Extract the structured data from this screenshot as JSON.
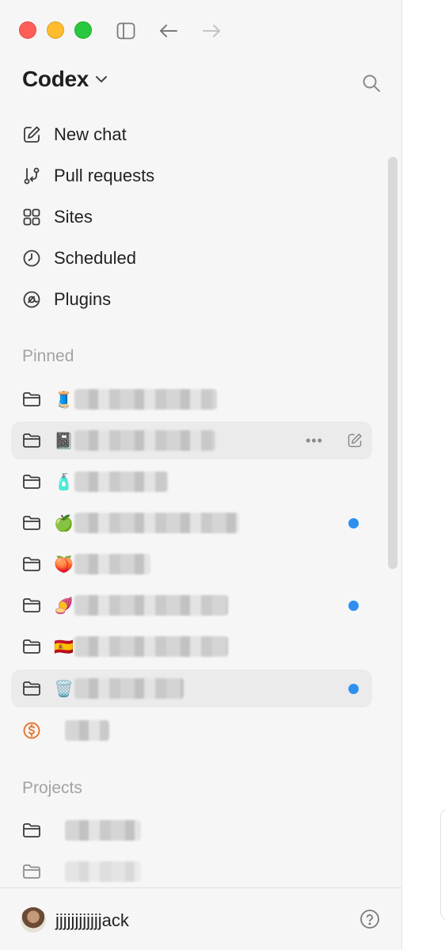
{
  "app": {
    "name": "Codex"
  },
  "nav": [
    {
      "id": "new-chat",
      "label": "New chat",
      "icon": "compose-icon"
    },
    {
      "id": "pull-requests",
      "label": "Pull requests",
      "icon": "git-pull-request-icon"
    },
    {
      "id": "sites",
      "label": "Sites",
      "icon": "grid-icon"
    },
    {
      "id": "scheduled",
      "label": "Scheduled",
      "icon": "clock-icon"
    },
    {
      "id": "plugins",
      "label": "Plugins",
      "icon": "plugin-icon"
    }
  ],
  "sections": {
    "pinned": "Pinned",
    "projects": "Projects"
  },
  "pinned": [
    {
      "emoji": "🧵",
      "unread": false,
      "highlighted": false
    },
    {
      "emoji": "📓",
      "unread": false,
      "highlighted": true,
      "actions": [
        "more",
        "edit"
      ]
    },
    {
      "emoji": "🧴",
      "unread": false,
      "highlighted": false
    },
    {
      "emoji": "🍏",
      "unread": true,
      "highlighted": false
    },
    {
      "emoji": "🍑",
      "unread": false,
      "highlighted": false
    },
    {
      "emoji": "🍠",
      "unread": true,
      "highlighted": false
    },
    {
      "emoji": "🇪🇸",
      "unread": false,
      "highlighted": false
    },
    {
      "emoji": "🗑️",
      "unread": true,
      "highlighted": true
    },
    {
      "emoji": "",
      "icon": "dollar-circle-icon",
      "unread": false,
      "highlighted": false
    }
  ],
  "user": {
    "name": "jjjjjjjjjjjjack"
  },
  "colors": {
    "accent_dot": "#2f8fef",
    "dollar_icon": "#e8742c",
    "sidebar_bg": "#f6f6f6"
  }
}
